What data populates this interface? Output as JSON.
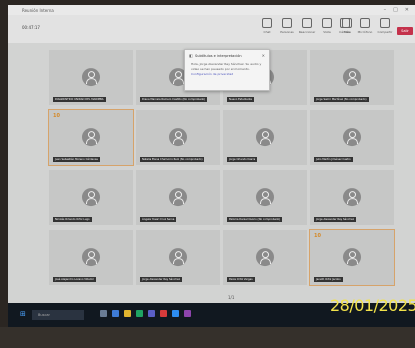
{
  "window": {
    "title": "Reunión Interna"
  },
  "toolbar": {
    "timer": "00:47:17",
    "buttons": [
      "Chat",
      "Personas",
      "Reaccionar",
      "Vista",
      "Más",
      "Cámara",
      "Micrófono",
      "Compartir"
    ],
    "leave_label": "Salir"
  },
  "popup": {
    "title": "Subtítulos e interpretación",
    "text": "Hola, Jorge Alexander Rey Sánchez. Su audio y video se han pausado por el momento.",
    "link": "Configuración de privacidad"
  },
  "tiles": [
    {
      "name": "DIAGNOSTICO UNIDAD DEL MARIMBA",
      "num": ""
    },
    {
      "name": "Diana Marcela Romero Castillo (No comprobado)",
      "num": ""
    },
    {
      "name": "Nuevo Estudiante",
      "num": ""
    },
    {
      "name": "Jorge Samir Martínez (No comprobado)",
      "num": ""
    },
    {
      "name": "Juan Sebastián Moreno Cárdenas",
      "num": "10"
    },
    {
      "name": "Natalia Elena Chamorro Ruiz (No comprobado)",
      "num": ""
    },
    {
      "name": "Jorge Orlando Ibarra",
      "num": ""
    },
    {
      "name": "Julio Martín Jiménez Castro",
      "num": ""
    },
    {
      "name": "Nicolás Orlando Ortiz Lugo",
      "num": ""
    },
    {
      "name": "Ángela Yosari Cruz Serna",
      "num": ""
    },
    {
      "name": "Paloma Daniel Osorio (No comprobado)",
      "num": ""
    },
    {
      "name": "Jorge Alexander Rey Sánchez",
      "num": ""
    },
    {
      "name": "José Alejandro Lozano Villamil",
      "num": ""
    },
    {
      "name": "Jorge Alexander Rey Sánchez",
      "num": ""
    },
    {
      "name": "Paola Ortiz Vargas",
      "num": ""
    },
    {
      "name": "Janeth Ortiz Jacobo",
      "num": "10"
    }
  ],
  "pager": "1/1",
  "taskbar": {
    "search_placeholder": "Buscar"
  },
  "date_stamp": "28/01/2025",
  "colors": {
    "accent": "#4b53bc",
    "leave": "#c4314b",
    "date": "#f2e24a",
    "highlight": "#d6a36a"
  }
}
